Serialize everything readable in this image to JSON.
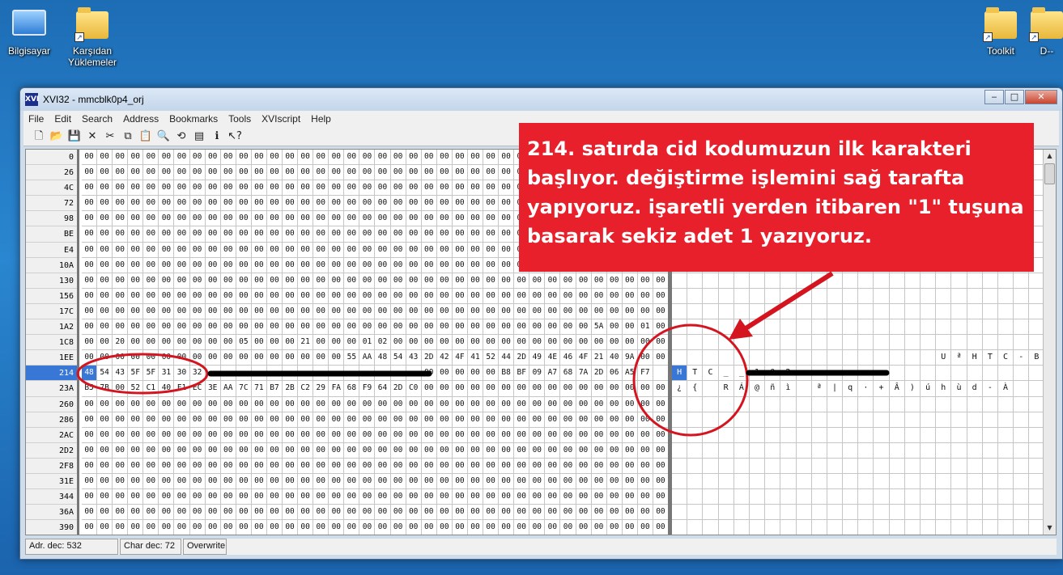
{
  "desktop": {
    "icons": [
      {
        "label": "Bilgisayar",
        "icon": "computer-icon"
      },
      {
        "label": "Karşıdan Yüklemeler",
        "icon": "downloads-folder-icon"
      },
      {
        "label": "Toolkit",
        "icon": "folder-icon"
      },
      {
        "label": "D--",
        "icon": "folder-icon"
      }
    ]
  },
  "window": {
    "title": "XVI32 - mmcblk0p4_orj",
    "app_icon_text": "XVI",
    "min": "‒",
    "max": "□",
    "close": "✕"
  },
  "menu": [
    "File",
    "Edit",
    "Search",
    "Address",
    "Bookmarks",
    "Tools",
    "XVIscript",
    "Help"
  ],
  "toolbar": [
    "new-icon",
    "open-icon",
    "save-icon",
    "delete-icon",
    "cut-icon",
    "copy-icon",
    "paste-icon",
    "find-icon",
    "replace-icon",
    "properties-icon",
    "script-icon",
    "help-icon"
  ],
  "rows": [
    {
      "addr": "0",
      "hex": [
        "00",
        "00",
        "00",
        "00",
        "00",
        "00",
        "00",
        "00",
        "00",
        "00",
        "00",
        "00",
        "00",
        "00",
        "00",
        "00",
        "00",
        "00",
        "00",
        "00",
        "00",
        "00",
        "00",
        "00",
        "00",
        "00",
        "00",
        "00",
        "00",
        "00",
        "00",
        "00",
        "00",
        "00",
        "00",
        "00",
        "00",
        "00"
      ],
      "text": []
    },
    {
      "addr": "26",
      "hex": [
        "00",
        "00",
        "00",
        "00",
        "00",
        "00",
        "00",
        "00",
        "00",
        "00",
        "00",
        "00",
        "00",
        "00",
        "00",
        "00",
        "00",
        "00",
        "00",
        "00",
        "00",
        "00",
        "00",
        "00",
        "00",
        "00",
        "00",
        "00",
        "00",
        "00",
        "00",
        "00",
        "00",
        "00",
        "00",
        "00",
        "00",
        "00"
      ],
      "text": []
    },
    {
      "addr": "4C",
      "hex": [
        "00",
        "00",
        "00",
        "00",
        "00",
        "00",
        "00",
        "00",
        "00",
        "00",
        "00",
        "00",
        "00",
        "00",
        "00",
        "00",
        "00",
        "00",
        "00",
        "00",
        "00",
        "00",
        "00",
        "00",
        "00",
        "00",
        "00",
        "00",
        "00",
        "00",
        "00",
        "00",
        "00",
        "00",
        "00",
        "00",
        "00",
        "00"
      ],
      "text": []
    },
    {
      "addr": "72",
      "hex": [
        "00",
        "00",
        "00",
        "00",
        "00",
        "00",
        "00",
        "00",
        "00",
        "00",
        "00",
        "00",
        "00",
        "00",
        "00",
        "00",
        "00",
        "00",
        "00",
        "00",
        "00",
        "00",
        "00",
        "00",
        "00",
        "00",
        "00",
        "00",
        "00",
        "00",
        "00",
        "00",
        "00",
        "00",
        "00",
        "00",
        "00",
        "00"
      ],
      "text": []
    },
    {
      "addr": "98",
      "hex": [
        "00",
        "00",
        "00",
        "00",
        "00",
        "00",
        "00",
        "00",
        "00",
        "00",
        "00",
        "00",
        "00",
        "00",
        "00",
        "00",
        "00",
        "00",
        "00",
        "00",
        "00",
        "00",
        "00",
        "00",
        "00",
        "00",
        "00",
        "00",
        "00",
        "00",
        "00",
        "00",
        "00",
        "00",
        "00",
        "00",
        "00",
        "00"
      ],
      "text": []
    },
    {
      "addr": "BE",
      "hex": [
        "00",
        "00",
        "00",
        "00",
        "00",
        "00",
        "00",
        "00",
        "00",
        "00",
        "00",
        "00",
        "00",
        "00",
        "00",
        "00",
        "00",
        "00",
        "00",
        "00",
        "00",
        "00",
        "00",
        "00",
        "00",
        "00",
        "00",
        "00",
        "00",
        "00",
        "00",
        "00",
        "00",
        "00",
        "00",
        "00",
        "00",
        "00"
      ],
      "text": []
    },
    {
      "addr": "E4",
      "hex": [
        "00",
        "00",
        "00",
        "00",
        "00",
        "00",
        "00",
        "00",
        "00",
        "00",
        "00",
        "00",
        "00",
        "00",
        "00",
        "00",
        "00",
        "00",
        "00",
        "00",
        "00",
        "00",
        "00",
        "00",
        "00",
        "00",
        "00",
        "00",
        "00",
        "00",
        "00",
        "00",
        "00",
        "00",
        "00",
        "00",
        "00",
        "00"
      ],
      "text": []
    },
    {
      "addr": "10A",
      "hex": [
        "00",
        "00",
        "00",
        "00",
        "00",
        "00",
        "00",
        "00",
        "00",
        "00",
        "00",
        "00",
        "00",
        "00",
        "00",
        "00",
        "00",
        "00",
        "00",
        "00",
        "00",
        "00",
        "00",
        "00",
        "00",
        "00",
        "00",
        "00",
        "00",
        "00",
        "00",
        "00",
        "00",
        "00",
        "00",
        "00",
        "00",
        "00"
      ],
      "text": []
    },
    {
      "addr": "130",
      "hex": [
        "00",
        "00",
        "00",
        "00",
        "00",
        "00",
        "00",
        "00",
        "00",
        "00",
        "00",
        "00",
        "00",
        "00",
        "00",
        "00",
        "00",
        "00",
        "00",
        "00",
        "00",
        "00",
        "00",
        "00",
        "00",
        "00",
        "00",
        "00",
        "00",
        "00",
        "00",
        "00",
        "00",
        "00",
        "00",
        "00",
        "00",
        "00"
      ],
      "text": []
    },
    {
      "addr": "156",
      "hex": [
        "00",
        "00",
        "00",
        "00",
        "00",
        "00",
        "00",
        "00",
        "00",
        "00",
        "00",
        "00",
        "00",
        "00",
        "00",
        "00",
        "00",
        "00",
        "00",
        "00",
        "00",
        "00",
        "00",
        "00",
        "00",
        "00",
        "00",
        "00",
        "00",
        "00",
        "00",
        "00",
        "00",
        "00",
        "00",
        "00",
        "00",
        "00"
      ],
      "text": []
    },
    {
      "addr": "17C",
      "hex": [
        "00",
        "00",
        "00",
        "00",
        "00",
        "00",
        "00",
        "00",
        "00",
        "00",
        "00",
        "00",
        "00",
        "00",
        "00",
        "00",
        "00",
        "00",
        "00",
        "00",
        "00",
        "00",
        "00",
        "00",
        "00",
        "00",
        "00",
        "00",
        "00",
        "00",
        "00",
        "00",
        "00",
        "00",
        "00",
        "00",
        "00",
        "00"
      ],
      "text": []
    },
    {
      "addr": "1A2",
      "hex": [
        "00",
        "00",
        "00",
        "00",
        "00",
        "00",
        "00",
        "00",
        "00",
        "00",
        "00",
        "00",
        "00",
        "00",
        "00",
        "00",
        "00",
        "00",
        "00",
        "00",
        "00",
        "00",
        "00",
        "00",
        "00",
        "00",
        "00",
        "00",
        "00",
        "00",
        "00",
        "00",
        "00",
        "5A",
        "00",
        "00",
        "01",
        "00"
      ],
      "text": [
        "",
        "",
        "",
        "",
        "",
        "",
        "",
        "",
        "",
        "",
        "",
        "",
        "",
        "",
        "",
        "",
        "",
        "",
        "",
        "",
        "",
        "",
        "",
        "",
        "",
        "",
        "",
        "",
        "",
        "",
        "",
        "",
        "",
        "Z",
        "",
        "",
        "",
        ""
      ]
    },
    {
      "addr": "1C8",
      "hex": [
        "00",
        "00",
        "20",
        "00",
        "00",
        "00",
        "00",
        "00",
        "00",
        "00",
        "05",
        "00",
        "00",
        "00",
        "21",
        "00",
        "00",
        "00",
        "01",
        "02",
        "00",
        "00",
        "00",
        "00",
        "00",
        "00",
        "00",
        "00",
        "00",
        "00",
        "00",
        "00",
        "00",
        "00",
        "00",
        "00",
        "00",
        "00"
      ],
      "text": [
        "",
        "",
        "",
        "",
        "",
        "",
        "",
        "",
        "",
        "",
        "",
        "",
        "",
        "",
        "",
        "",
        "",
        "",
        "",
        "",
        "",
        "",
        "",
        "",
        "",
        "",
        "",
        "",
        "",
        "",
        "",
        "",
        "",
        "",
        "",
        "",
        "",
        ""
      ]
    },
    {
      "addr": "1EE",
      "hex": [
        "00",
        "00",
        "00",
        "00",
        "00",
        "00",
        "00",
        "00",
        "00",
        "00",
        "00",
        "00",
        "00",
        "00",
        "00",
        "00",
        "00",
        "55",
        "AA",
        "48",
        "54",
        "43",
        "2D",
        "42",
        "4F",
        "41",
        "52",
        "44",
        "2D",
        "49",
        "4E",
        "46",
        "4F",
        "21",
        "40",
        "9A",
        "00",
        "00"
      ],
      "text": [
        "",
        "",
        "",
        "",
        "",
        "",
        "",
        "",
        "",
        "",
        "",
        "",
        "",
        "",
        "",
        "",
        "",
        "U",
        "ª",
        "H",
        "T",
        "C",
        "-",
        "B",
        "O",
        "A",
        "R",
        "D",
        "-",
        "I",
        "N",
        "F",
        "O",
        "!",
        "@",
        "š",
        "",
        ""
      ]
    },
    {
      "addr": "214",
      "selected": true,
      "hex": [
        "48",
        "54",
        "43",
        "5F",
        "5F",
        "31",
        "30",
        "32",
        "",
        "",
        "",
        "",
        "",
        "",
        "",
        "",
        "",
        "",
        "",
        "",
        "",
        "",
        "00",
        "00",
        "00",
        "00",
        "00",
        "B8",
        "BF",
        "09",
        "A7",
        "68",
        "7A",
        "2D",
        "06",
        "A5",
        "F7",
        ""
      ],
      "text": [
        "H",
        "T",
        "C",
        "_",
        "_",
        "1",
        "0",
        "2",
        "",
        "",
        "",
        "",
        "",
        "",
        "",
        "",
        "",
        "",
        "",
        "",
        "",
        "",
        "",
        "",
        "",
        "",
        "",
        "¸",
        "¿",
        "",
        "§",
        "h",
        "z",
        "-",
        "-",
        "¥",
        "÷",
        ""
      ]
    },
    {
      "addr": "23A",
      "hex": [
        "B5",
        "7B",
        "00",
        "52",
        "C1",
        "40",
        "F1",
        "EC",
        "3E",
        "AA",
        "7C",
        "71",
        "B7",
        "2B",
        "C2",
        "29",
        "FA",
        "68",
        "F9",
        "64",
        "2D",
        "C0",
        "00",
        "00",
        "00",
        "00",
        "00",
        "00",
        "00",
        "00",
        "00",
        "00",
        "00",
        "00",
        "00",
        "00",
        "00",
        "00"
      ],
      "text": [
        "¿",
        "{",
        "",
        "R",
        "Á",
        "@",
        "ñ",
        "ì",
        "",
        "ª",
        "|",
        "q",
        "·",
        "+",
        "Â",
        ")",
        "ú",
        "h",
        "ù",
        "d",
        "-",
        "À",
        "",
        "",
        "",
        "",
        "",
        "",
        "",
        "",
        "",
        "",
        "",
        "",
        "",
        "",
        "",
        ""
      ]
    },
    {
      "addr": "260",
      "hex": [
        "00",
        "00",
        "00",
        "00",
        "00",
        "00",
        "00",
        "00",
        "00",
        "00",
        "00",
        "00",
        "00",
        "00",
        "00",
        "00",
        "00",
        "00",
        "00",
        "00",
        "00",
        "00",
        "00",
        "00",
        "00",
        "00",
        "00",
        "00",
        "00",
        "00",
        "00",
        "00",
        "00",
        "00",
        "00",
        "00",
        "00",
        "00"
      ],
      "text": []
    },
    {
      "addr": "286",
      "hex": [
        "00",
        "00",
        "00",
        "00",
        "00",
        "00",
        "00",
        "00",
        "00",
        "00",
        "00",
        "00",
        "00",
        "00",
        "00",
        "00",
        "00",
        "00",
        "00",
        "00",
        "00",
        "00",
        "00",
        "00",
        "00",
        "00",
        "00",
        "00",
        "00",
        "00",
        "00",
        "00",
        "00",
        "00",
        "00",
        "00",
        "00",
        "00"
      ],
      "text": []
    },
    {
      "addr": "2AC",
      "hex": [
        "00",
        "00",
        "00",
        "00",
        "00",
        "00",
        "00",
        "00",
        "00",
        "00",
        "00",
        "00",
        "00",
        "00",
        "00",
        "00",
        "00",
        "00",
        "00",
        "00",
        "00",
        "00",
        "00",
        "00",
        "00",
        "00",
        "00",
        "00",
        "00",
        "00",
        "00",
        "00",
        "00",
        "00",
        "00",
        "00",
        "00",
        "00"
      ],
      "text": []
    },
    {
      "addr": "2D2",
      "hex": [
        "00",
        "00",
        "00",
        "00",
        "00",
        "00",
        "00",
        "00",
        "00",
        "00",
        "00",
        "00",
        "00",
        "00",
        "00",
        "00",
        "00",
        "00",
        "00",
        "00",
        "00",
        "00",
        "00",
        "00",
        "00",
        "00",
        "00",
        "00",
        "00",
        "00",
        "00",
        "00",
        "00",
        "00",
        "00",
        "00",
        "00",
        "00"
      ],
      "text": []
    },
    {
      "addr": "2F8",
      "hex": [
        "00",
        "00",
        "00",
        "00",
        "00",
        "00",
        "00",
        "00",
        "00",
        "00",
        "00",
        "00",
        "00",
        "00",
        "00",
        "00",
        "00",
        "00",
        "00",
        "00",
        "00",
        "00",
        "00",
        "00",
        "00",
        "00",
        "00",
        "00",
        "00",
        "00",
        "00",
        "00",
        "00",
        "00",
        "00",
        "00",
        "00",
        "00"
      ],
      "text": []
    },
    {
      "addr": "31E",
      "hex": [
        "00",
        "00",
        "00",
        "00",
        "00",
        "00",
        "00",
        "00",
        "00",
        "00",
        "00",
        "00",
        "00",
        "00",
        "00",
        "00",
        "00",
        "00",
        "00",
        "00",
        "00",
        "00",
        "00",
        "00",
        "00",
        "00",
        "00",
        "00",
        "00",
        "00",
        "00",
        "00",
        "00",
        "00",
        "00",
        "00",
        "00",
        "00"
      ],
      "text": []
    },
    {
      "addr": "344",
      "hex": [
        "00",
        "00",
        "00",
        "00",
        "00",
        "00",
        "00",
        "00",
        "00",
        "00",
        "00",
        "00",
        "00",
        "00",
        "00",
        "00",
        "00",
        "00",
        "00",
        "00",
        "00",
        "00",
        "00",
        "00",
        "00",
        "00",
        "00",
        "00",
        "00",
        "00",
        "00",
        "00",
        "00",
        "00",
        "00",
        "00",
        "00",
        "00"
      ],
      "text": []
    },
    {
      "addr": "36A",
      "hex": [
        "00",
        "00",
        "00",
        "00",
        "00",
        "00",
        "00",
        "00",
        "00",
        "00",
        "00",
        "00",
        "00",
        "00",
        "00",
        "00",
        "00",
        "00",
        "00",
        "00",
        "00",
        "00",
        "00",
        "00",
        "00",
        "00",
        "00",
        "00",
        "00",
        "00",
        "00",
        "00",
        "00",
        "00",
        "00",
        "00",
        "00",
        "00"
      ],
      "text": []
    },
    {
      "addr": "390",
      "hex": [
        "00",
        "00",
        "00",
        "00",
        "00",
        "00",
        "00",
        "00",
        "00",
        "00",
        "00",
        "00",
        "00",
        "00",
        "00",
        "00",
        "00",
        "00",
        "00",
        "00",
        "00",
        "00",
        "00",
        "00",
        "00",
        "00",
        "00",
        "00",
        "00",
        "00",
        "00",
        "00",
        "00",
        "00",
        "00",
        "00",
        "00",
        "00"
      ],
      "text": []
    }
  ],
  "text_extra": {
    "row_1C8": "|   !    ¬",
    "row_214_tail": ", ¿  §hz--¥÷",
    "row_23A_tail": "",
    "row_1EE_tail": ""
  },
  "statusbar": {
    "address": "Adr. dec: 532",
    "char": "Char dec: 72",
    "mode": "Overwrite"
  },
  "annotation": {
    "text": "214. satırda cid kodumuzun ilk karakteri başlıyor. değiştirme işlemini sağ tarafta yapıyoruz. işaretli yerden itibaren \"1\" tuşuna basarak sekiz adet 1 yazıyoruz.",
    "color": "#e8202b"
  }
}
